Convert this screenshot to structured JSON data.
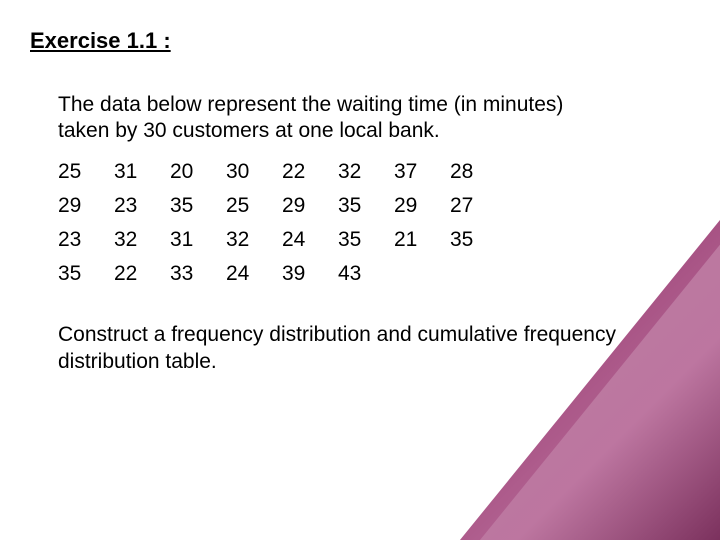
{
  "title": "Exercise 1.1 :",
  "intro": "The data below represent the waiting time (in minutes) taken by 30 customers at one local bank.",
  "rows": [
    [
      "25",
      "31",
      "20",
      "30",
      "22",
      "32",
      "37",
      "28"
    ],
    [
      "29",
      "23",
      "35",
      "25",
      "29",
      "35",
      "29",
      "27"
    ],
    [
      "23",
      "32",
      "31",
      "32",
      "24",
      "35",
      "21",
      "35"
    ],
    [
      "35",
      "22",
      "33",
      "24",
      "39",
      "43",
      "",
      ""
    ]
  ],
  "instruction": "Construct a frequency distribution and cumulative frequency distribution table."
}
